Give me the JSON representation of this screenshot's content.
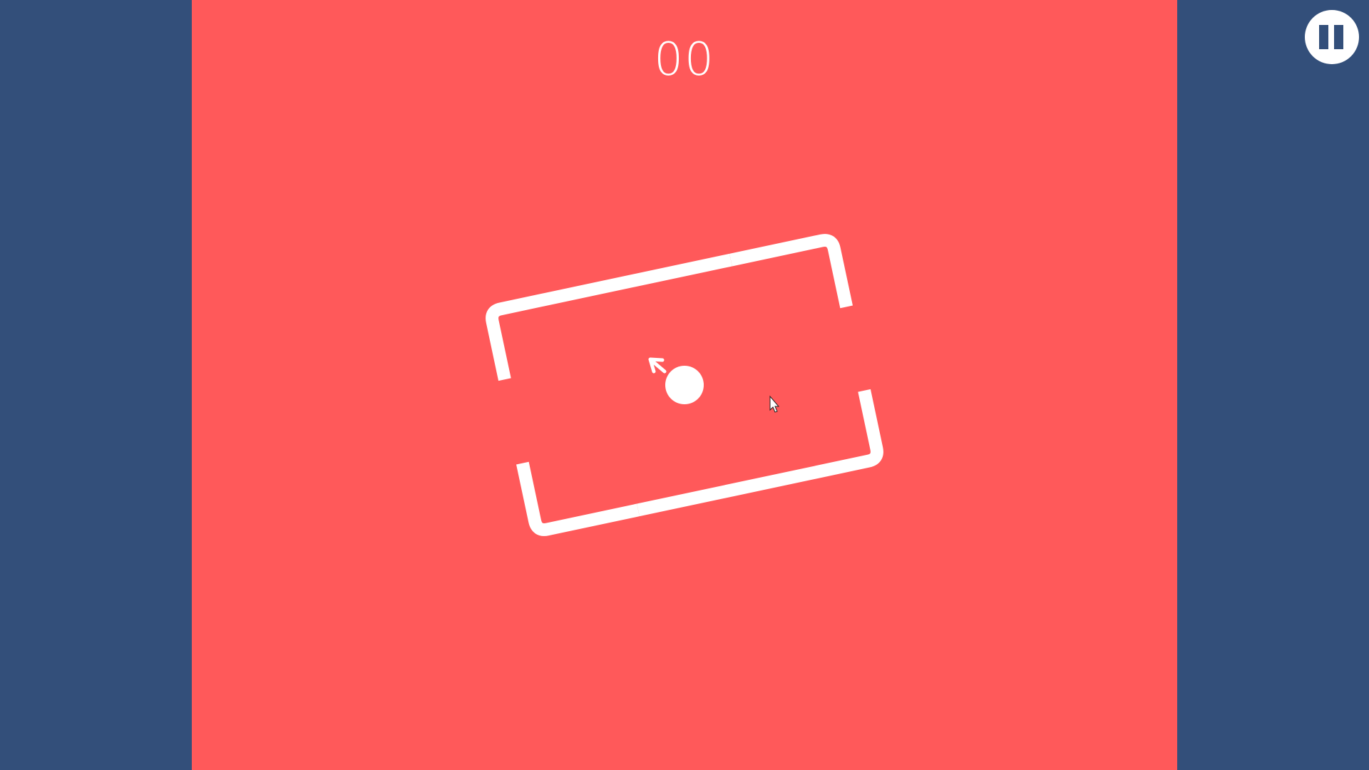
{
  "game": {
    "score": "00",
    "colors": {
      "background": "#334f7a",
      "play_area": "#ff595a",
      "foreground": "#ffffff"
    },
    "icons": {
      "direction": "arrow-up-left-icon",
      "pause": "pause-icon",
      "cursor": "mouse-pointer-icon"
    }
  }
}
